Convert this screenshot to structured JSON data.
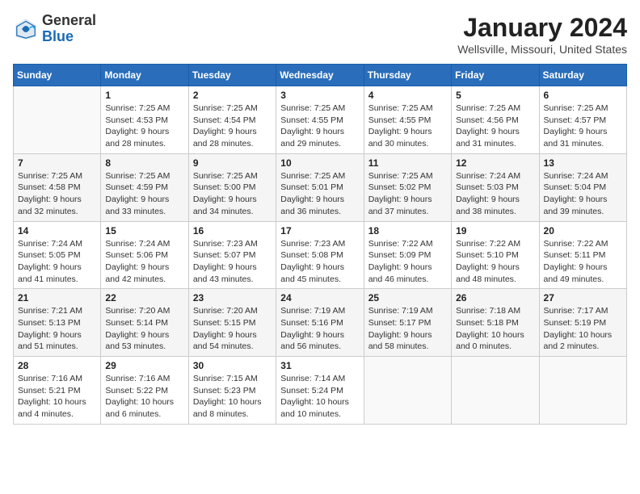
{
  "logo": {
    "general": "General",
    "blue": "Blue"
  },
  "title": "January 2024",
  "subtitle": "Wellsville, Missouri, United States",
  "days_of_week": [
    "Sunday",
    "Monday",
    "Tuesday",
    "Wednesday",
    "Thursday",
    "Friday",
    "Saturday"
  ],
  "weeks": [
    [
      {
        "day": "",
        "sunrise": "",
        "sunset": "",
        "daylight": ""
      },
      {
        "day": "1",
        "sunrise": "Sunrise: 7:25 AM",
        "sunset": "Sunset: 4:53 PM",
        "daylight": "Daylight: 9 hours and 28 minutes."
      },
      {
        "day": "2",
        "sunrise": "Sunrise: 7:25 AM",
        "sunset": "Sunset: 4:54 PM",
        "daylight": "Daylight: 9 hours and 28 minutes."
      },
      {
        "day": "3",
        "sunrise": "Sunrise: 7:25 AM",
        "sunset": "Sunset: 4:55 PM",
        "daylight": "Daylight: 9 hours and 29 minutes."
      },
      {
        "day": "4",
        "sunrise": "Sunrise: 7:25 AM",
        "sunset": "Sunset: 4:55 PM",
        "daylight": "Daylight: 9 hours and 30 minutes."
      },
      {
        "day": "5",
        "sunrise": "Sunrise: 7:25 AM",
        "sunset": "Sunset: 4:56 PM",
        "daylight": "Daylight: 9 hours and 31 minutes."
      },
      {
        "day": "6",
        "sunrise": "Sunrise: 7:25 AM",
        "sunset": "Sunset: 4:57 PM",
        "daylight": "Daylight: 9 hours and 31 minutes."
      }
    ],
    [
      {
        "day": "7",
        "sunrise": "Sunrise: 7:25 AM",
        "sunset": "Sunset: 4:58 PM",
        "daylight": "Daylight: 9 hours and 32 minutes."
      },
      {
        "day": "8",
        "sunrise": "Sunrise: 7:25 AM",
        "sunset": "Sunset: 4:59 PM",
        "daylight": "Daylight: 9 hours and 33 minutes."
      },
      {
        "day": "9",
        "sunrise": "Sunrise: 7:25 AM",
        "sunset": "Sunset: 5:00 PM",
        "daylight": "Daylight: 9 hours and 34 minutes."
      },
      {
        "day": "10",
        "sunrise": "Sunrise: 7:25 AM",
        "sunset": "Sunset: 5:01 PM",
        "daylight": "Daylight: 9 hours and 36 minutes."
      },
      {
        "day": "11",
        "sunrise": "Sunrise: 7:25 AM",
        "sunset": "Sunset: 5:02 PM",
        "daylight": "Daylight: 9 hours and 37 minutes."
      },
      {
        "day": "12",
        "sunrise": "Sunrise: 7:24 AM",
        "sunset": "Sunset: 5:03 PM",
        "daylight": "Daylight: 9 hours and 38 minutes."
      },
      {
        "day": "13",
        "sunrise": "Sunrise: 7:24 AM",
        "sunset": "Sunset: 5:04 PM",
        "daylight": "Daylight: 9 hours and 39 minutes."
      }
    ],
    [
      {
        "day": "14",
        "sunrise": "Sunrise: 7:24 AM",
        "sunset": "Sunset: 5:05 PM",
        "daylight": "Daylight: 9 hours and 41 minutes."
      },
      {
        "day": "15",
        "sunrise": "Sunrise: 7:24 AM",
        "sunset": "Sunset: 5:06 PM",
        "daylight": "Daylight: 9 hours and 42 minutes."
      },
      {
        "day": "16",
        "sunrise": "Sunrise: 7:23 AM",
        "sunset": "Sunset: 5:07 PM",
        "daylight": "Daylight: 9 hours and 43 minutes."
      },
      {
        "day": "17",
        "sunrise": "Sunrise: 7:23 AM",
        "sunset": "Sunset: 5:08 PM",
        "daylight": "Daylight: 9 hours and 45 minutes."
      },
      {
        "day": "18",
        "sunrise": "Sunrise: 7:22 AM",
        "sunset": "Sunset: 5:09 PM",
        "daylight": "Daylight: 9 hours and 46 minutes."
      },
      {
        "day": "19",
        "sunrise": "Sunrise: 7:22 AM",
        "sunset": "Sunset: 5:10 PM",
        "daylight": "Daylight: 9 hours and 48 minutes."
      },
      {
        "day": "20",
        "sunrise": "Sunrise: 7:22 AM",
        "sunset": "Sunset: 5:11 PM",
        "daylight": "Daylight: 9 hours and 49 minutes."
      }
    ],
    [
      {
        "day": "21",
        "sunrise": "Sunrise: 7:21 AM",
        "sunset": "Sunset: 5:13 PM",
        "daylight": "Daylight: 9 hours and 51 minutes."
      },
      {
        "day": "22",
        "sunrise": "Sunrise: 7:20 AM",
        "sunset": "Sunset: 5:14 PM",
        "daylight": "Daylight: 9 hours and 53 minutes."
      },
      {
        "day": "23",
        "sunrise": "Sunrise: 7:20 AM",
        "sunset": "Sunset: 5:15 PM",
        "daylight": "Daylight: 9 hours and 54 minutes."
      },
      {
        "day": "24",
        "sunrise": "Sunrise: 7:19 AM",
        "sunset": "Sunset: 5:16 PM",
        "daylight": "Daylight: 9 hours and 56 minutes."
      },
      {
        "day": "25",
        "sunrise": "Sunrise: 7:19 AM",
        "sunset": "Sunset: 5:17 PM",
        "daylight": "Daylight: 9 hours and 58 minutes."
      },
      {
        "day": "26",
        "sunrise": "Sunrise: 7:18 AM",
        "sunset": "Sunset: 5:18 PM",
        "daylight": "Daylight: 10 hours and 0 minutes."
      },
      {
        "day": "27",
        "sunrise": "Sunrise: 7:17 AM",
        "sunset": "Sunset: 5:19 PM",
        "daylight": "Daylight: 10 hours and 2 minutes."
      }
    ],
    [
      {
        "day": "28",
        "sunrise": "Sunrise: 7:16 AM",
        "sunset": "Sunset: 5:21 PM",
        "daylight": "Daylight: 10 hours and 4 minutes."
      },
      {
        "day": "29",
        "sunrise": "Sunrise: 7:16 AM",
        "sunset": "Sunset: 5:22 PM",
        "daylight": "Daylight: 10 hours and 6 minutes."
      },
      {
        "day": "30",
        "sunrise": "Sunrise: 7:15 AM",
        "sunset": "Sunset: 5:23 PM",
        "daylight": "Daylight: 10 hours and 8 minutes."
      },
      {
        "day": "31",
        "sunrise": "Sunrise: 7:14 AM",
        "sunset": "Sunset: 5:24 PM",
        "daylight": "Daylight: 10 hours and 10 minutes."
      },
      {
        "day": "",
        "sunrise": "",
        "sunset": "",
        "daylight": ""
      },
      {
        "day": "",
        "sunrise": "",
        "sunset": "",
        "daylight": ""
      },
      {
        "day": "",
        "sunrise": "",
        "sunset": "",
        "daylight": ""
      }
    ]
  ]
}
